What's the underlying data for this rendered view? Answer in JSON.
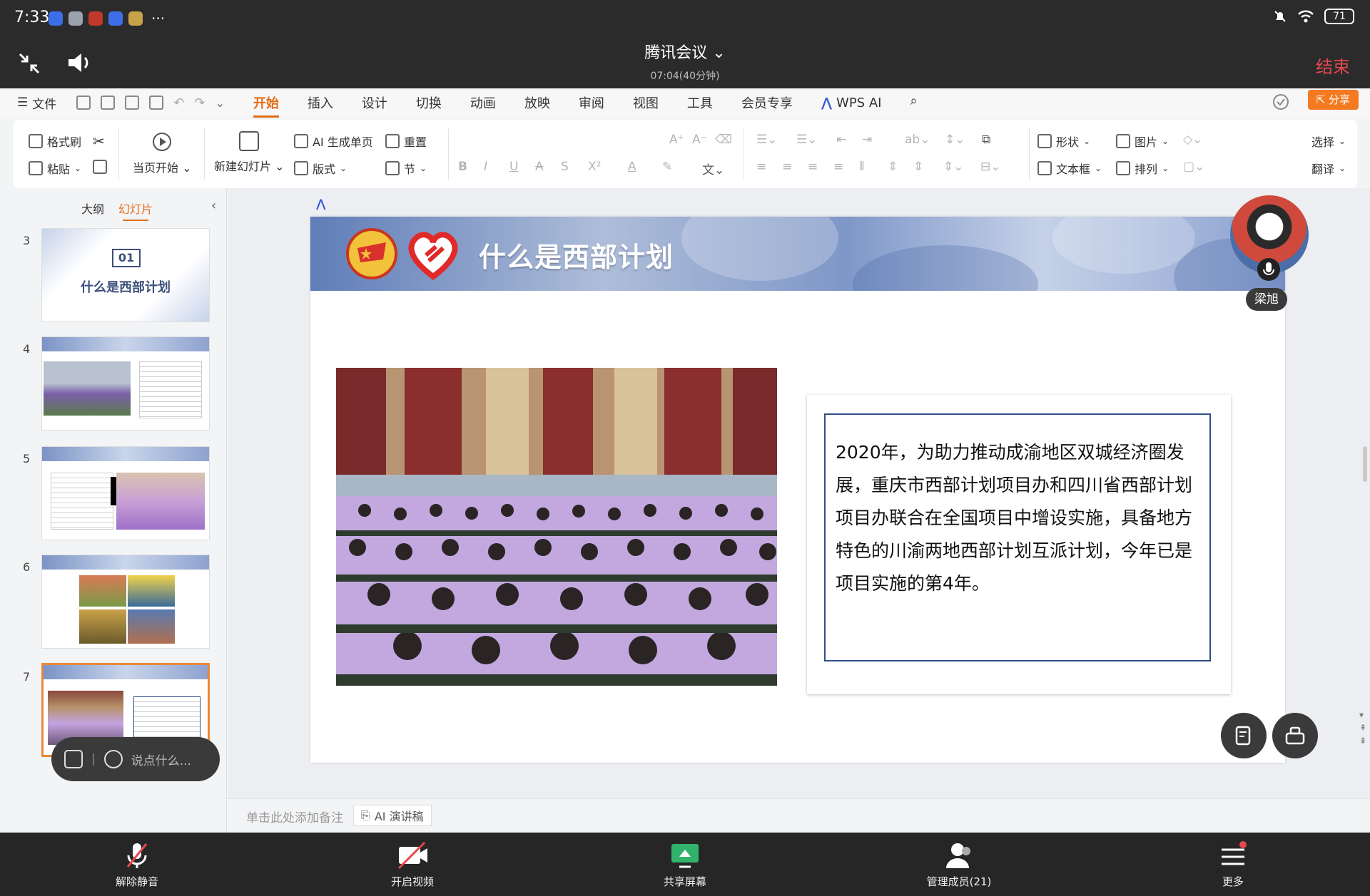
{
  "status": {
    "time": "7:33",
    "battery": "71",
    "more": "···"
  },
  "meeting": {
    "title": "腾讯会议",
    "duration": "07:04(40分钟)",
    "end_label": "结束"
  },
  "menu": {
    "file": "文件",
    "tabs": [
      "开始",
      "插入",
      "设计",
      "切换",
      "动画",
      "放映",
      "审阅",
      "视图",
      "工具",
      "会员专享"
    ],
    "wps_ai": "WPS AI",
    "share": "分享"
  },
  "ribbon": {
    "format_painter": "格式刷",
    "paste": "粘贴",
    "play_current": "当页开始",
    "new_slide": "新建幻灯片",
    "ai_generate": "AI 生成单页",
    "layout": "版式",
    "reset": "重置",
    "section": "节",
    "shape": "形状",
    "picture": "图片",
    "select": "选择",
    "textbox": "文本框",
    "arrange": "排列",
    "translate": "翻译"
  },
  "sidebar": {
    "tab_outline": "大纲",
    "tab_slides": "幻灯片",
    "thumbs": [
      {
        "num": "3",
        "chapter": "01",
        "title": "什么是西部计划"
      },
      {
        "num": "4"
      },
      {
        "num": "5"
      },
      {
        "num": "6"
      },
      {
        "num": "7"
      }
    ],
    "chat_placeholder": "说点什么..."
  },
  "slide": {
    "title": "什么是西部计划",
    "body": "2020年，为助力推动成渝地区双城经济圈发展，重庆市西部计划项目办和四川省西部计划项目办联合在全国项目中增设实施，具备地方特色的川渝两地西部计划互派计划，今年已是项目实施的第4年。"
  },
  "notes": {
    "placeholder": "单击此处添加备注",
    "ai_talk": "AI 演讲稿"
  },
  "speaker": {
    "name": "梁旭"
  },
  "bottom": {
    "unmute": "解除静音",
    "video": "开启视频",
    "share": "共享屏幕",
    "members": "管理成员(21)",
    "more": "更多"
  }
}
